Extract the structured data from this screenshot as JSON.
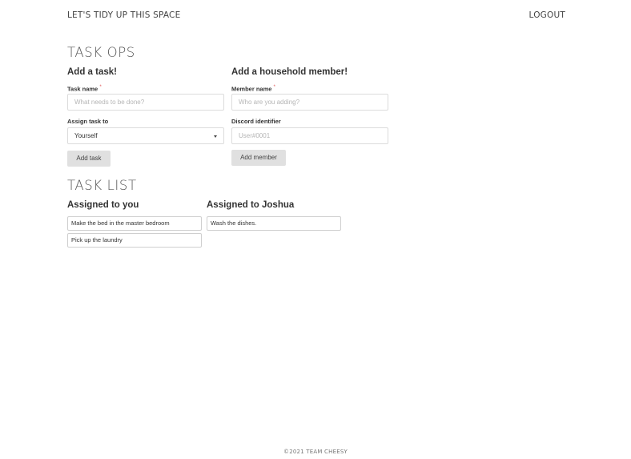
{
  "nav": {
    "brand": "LET'S TIDY UP THIS SPACE",
    "logout": "LOGOUT"
  },
  "task_ops": {
    "title": "TASK OPS",
    "add_task": {
      "heading": "Add a task!",
      "task_name_label": "Task name",
      "required_mark": "*",
      "task_name_placeholder": "What needs to be done?",
      "task_name_value": "",
      "assign_label": "Assign task to",
      "assign_selected": "Yourself",
      "button": "Add task"
    },
    "add_member": {
      "heading": "Add a household member!",
      "member_name_label": "Member name",
      "required_mark": "*",
      "member_name_placeholder": "Who are you adding?",
      "member_name_value": "",
      "discord_label": "Discord identifier",
      "discord_placeholder": "User#0001",
      "discord_value": "",
      "button": "Add member"
    }
  },
  "task_list": {
    "title": "TASK LIST",
    "groups": [
      {
        "heading": "Assigned to you",
        "tasks": [
          "Make the bed in the master bedroom",
          "Pick up the laundry"
        ]
      },
      {
        "heading": "Assigned to Joshua",
        "tasks": [
          "Wash the dishes."
        ]
      }
    ]
  },
  "footer": {
    "text": "©2021 TEAM CHEESY"
  },
  "colors": {
    "button_bg": "#e0e0e0",
    "required": "#e05252",
    "border": "#dcdcdc",
    "text": "#333333"
  },
  "icons": {
    "select_caret": "caret-down-icon"
  }
}
